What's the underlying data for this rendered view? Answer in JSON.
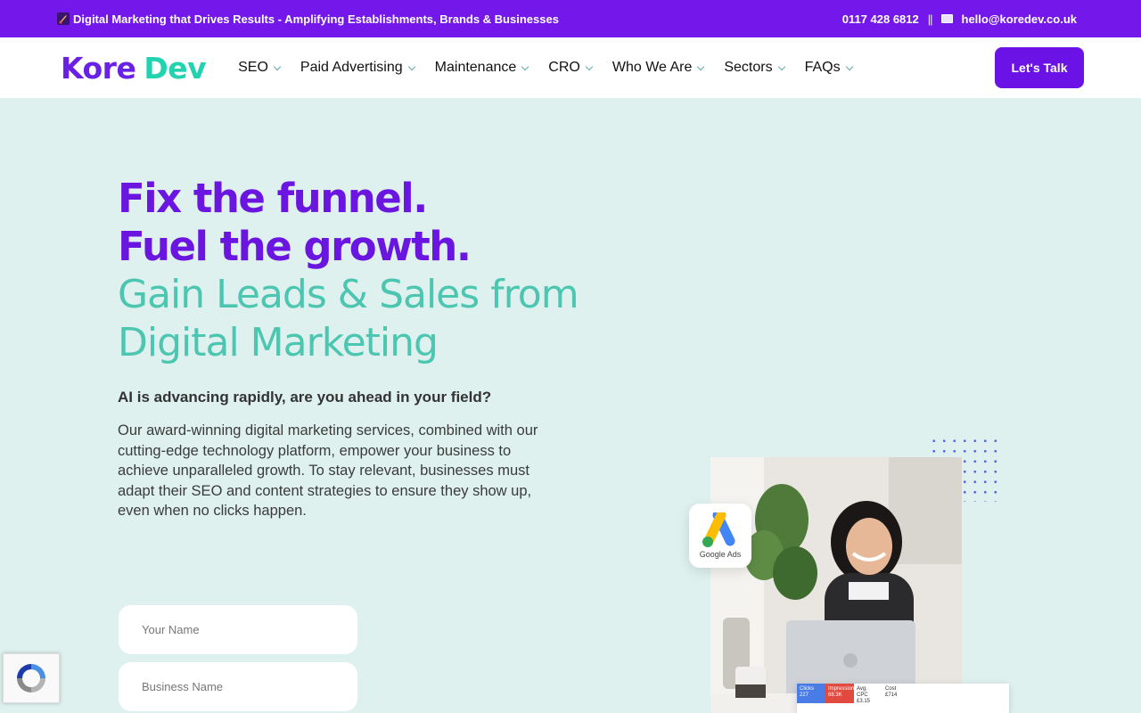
{
  "topbar": {
    "tagline": "Digital Marketing that Drives Results - Amplifying Establishments, Brands & Businesses",
    "phone": "0117 428 6812",
    "separator": "||",
    "email": "hello@koredev.co.uk"
  },
  "logo": {
    "part1": "Kore",
    "part2": "Dev"
  },
  "nav": {
    "items": [
      {
        "label": "SEO"
      },
      {
        "label": "Paid Advertising"
      },
      {
        "label": "Maintenance"
      },
      {
        "label": "CRO"
      },
      {
        "label": "Who We Are"
      },
      {
        "label": "Sectors"
      },
      {
        "label": "FAQs"
      }
    ],
    "cta_label": "Let's Talk"
  },
  "hero": {
    "headline_line1": "Fix the funnel.",
    "headline_line2": "Fuel the growth.",
    "subhead_line1": "Gain Leads & Sales from",
    "subhead_line2": "Digital Marketing",
    "question": "AI is advancing rapidly, are you ahead in your field?",
    "body": "Our award-winning digital marketing services, combined with our cutting-edge technology platform, empower your business to achieve unparalleled growth. To stay relevant, businesses must adapt their SEO and content strategies to ensure they show up, even when no clicks happen."
  },
  "form": {
    "name_placeholder": "Your Name",
    "business_placeholder": "Business Name"
  },
  "badge": {
    "label": "Google Ads"
  },
  "dashboard": {
    "cells": [
      {
        "title": "Clicks",
        "value": "227"
      },
      {
        "title": "Impressions",
        "value": "68.3K"
      },
      {
        "title": "Avg. CPC",
        "value": "£3.15"
      },
      {
        "title": "Cost",
        "value": "£714"
      }
    ]
  },
  "colors": {
    "brand_purple": "#6b16e0",
    "brand_teal": "#4cc6b0",
    "background": "#def1ee"
  }
}
